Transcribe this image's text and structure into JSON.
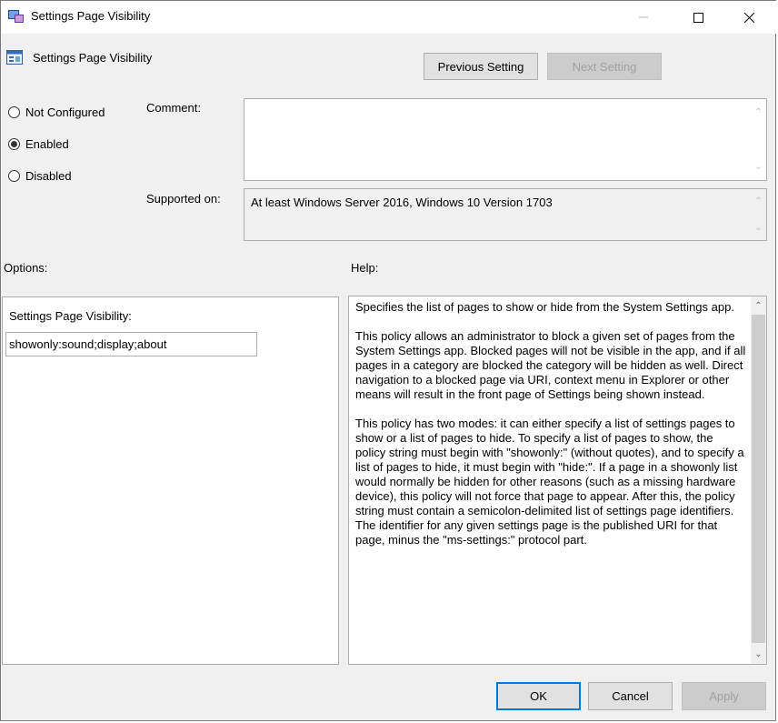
{
  "window": {
    "title": "Settings Page Visibility",
    "minimize_icon": "minimize-icon",
    "maximize_icon": "maximize-icon",
    "close_icon": "close-icon"
  },
  "header": {
    "title": "Settings Page Visibility",
    "prev_button": "Previous Setting",
    "next_button": "Next Setting"
  },
  "state": {
    "options": [
      "Not Configured",
      "Enabled",
      "Disabled"
    ],
    "selected": "Enabled"
  },
  "comment": {
    "label": "Comment:",
    "value": ""
  },
  "supported": {
    "label": "Supported on:",
    "value": "At least Windows Server 2016, Windows 10 Version 1703"
  },
  "options_section": {
    "label": "Options:",
    "field_label": "Settings Page Visibility:",
    "field_value": "showonly:sound;display;about"
  },
  "help_section": {
    "label": "Help:",
    "paragraphs": [
      "Specifies the list of pages to show or hide from the System Settings app.",
      "This policy allows an administrator to block a given set of pages from the System Settings app. Blocked pages will not be visible in the app, and if all pages in a category are blocked the category will be hidden as well. Direct navigation to a blocked page via URI, context menu in Explorer or other means will result in the front page of Settings being shown instead.",
      "This policy has two modes: it can either specify a list of settings pages to show or a list of pages to hide. To specify a list of pages to show, the policy string must begin with \"showonly:\" (without quotes), and to specify a list of pages to hide, it must begin with \"hide:\". If a page in a showonly list would normally be hidden for other reasons (such as a missing hardware device), this policy will not force that page to appear. After this, the policy string must contain a semicolon-delimited list of settings page identifiers. The identifier for any given settings page is the published URI for that page, minus the \"ms-settings:\" protocol part."
    ]
  },
  "footer": {
    "ok": "OK",
    "cancel": "Cancel",
    "apply": "Apply"
  },
  "colors": {
    "focus_border": "#0078d7",
    "window_bg": "#f0f0f0"
  }
}
